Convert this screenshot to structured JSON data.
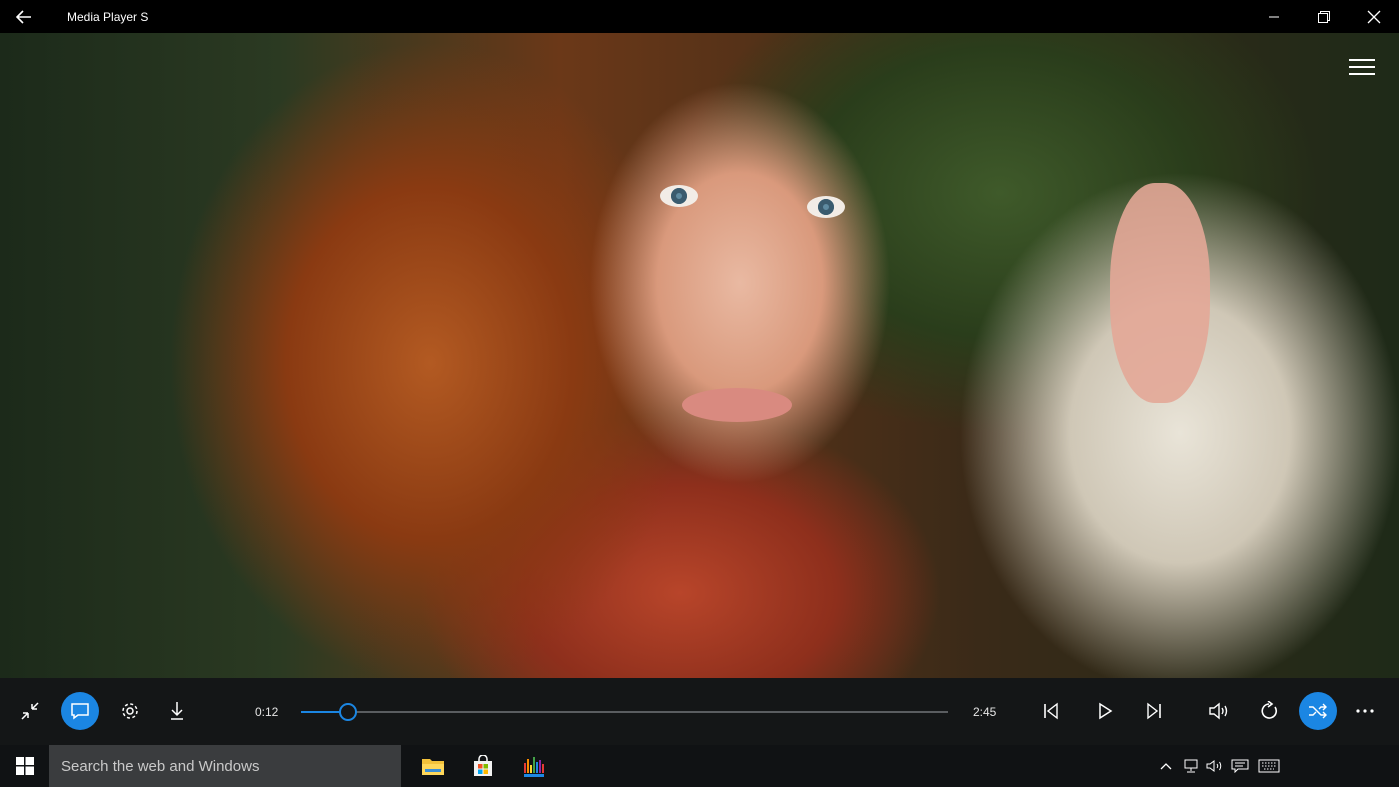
{
  "window": {
    "title": "Media Player S"
  },
  "player": {
    "elapsed": "0:12",
    "duration": "2:45",
    "progress_fraction": 0.073,
    "accent_color": "#1b86e3"
  },
  "icons": {
    "back": "back-arrow-icon",
    "minimize": "minimize-icon",
    "restore": "restore-icon",
    "close": "close-icon",
    "menu": "hamburger-menu-icon",
    "exit_fullscreen": "exit-fullscreen-icon",
    "subtitles": "subtitles-icon",
    "settings": "gear-icon",
    "download": "download-icon",
    "previous": "skip-previous-icon",
    "play": "play-icon",
    "next": "skip-next-icon",
    "volume": "volume-icon",
    "repeat": "repeat-icon",
    "shuffle": "shuffle-icon",
    "more": "more-options-icon"
  },
  "taskbar": {
    "search_placeholder": "Search the web and Windows",
    "apps": [
      "file-explorer-icon",
      "store-icon",
      "media-player-app-icon"
    ],
    "tray": [
      "chevron-up-icon",
      "network-icon",
      "speaker-icon",
      "action-center-icon",
      "keyboard-icon"
    ]
  }
}
